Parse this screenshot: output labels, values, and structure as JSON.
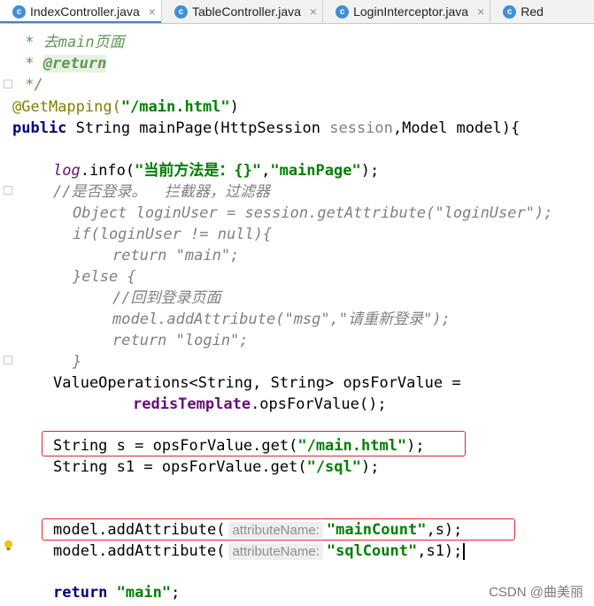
{
  "tabs": [
    {
      "label": "IndexController.java",
      "close": "×",
      "active": true
    },
    {
      "label": "TableController.java",
      "close": "×",
      "active": false
    },
    {
      "label": "LoginInterceptor.java",
      "close": "×",
      "active": false
    },
    {
      "label": "Red",
      "close": "",
      "active": false
    }
  ],
  "tab_icon_letter": "c",
  "code": {
    "l1": {
      "a": " * 去main页面"
    },
    "l2": {
      "a": " * ",
      "b": "@return"
    },
    "l3": {
      "a": " */"
    },
    "l4": {
      "ann": "@GetMapping(",
      "str": "\"/main.html\"",
      "end": ")"
    },
    "l5": {
      "kw": "public",
      "rest": " String mainPage(HttpSession ",
      "dim": "session",
      "rest2": ",Model model){"
    },
    "l6": {
      "log": "log",
      "a": ".info(",
      "s1": "\"当前方法是：{}\"",
      "b": ",",
      "s2": "\"mainPage\"",
      "c": ");"
    },
    "l7": {
      "a": "//是否登录。  拦截器，过滤器"
    },
    "l8": {
      "a": "Object loginUser = session.getAttribute(\"loginUser\");"
    },
    "l9": {
      "a": "if(loginUser != null){"
    },
    "l10": {
      "a": "return \"main\";"
    },
    "l11": {
      "a": "}else {"
    },
    "l12": {
      "a": "//回到登录页面"
    },
    "l13": {
      "a": "model.addAttribute(\"msg\",\"请重新登录\");"
    },
    "l14": {
      "a": "return \"login\";"
    },
    "l15": {
      "a": "}"
    },
    "l16": {
      "a": "ValueOperations<String, String> opsForValue ="
    },
    "l17": {
      "fld": "redisTemplate",
      "a": ".opsForValue();"
    },
    "l18": {
      "a": "String s = opsForValue.get(",
      "str": "\"/main.html\"",
      "end": ");"
    },
    "l19": {
      "a": "String s1 = opsForValue.get(",
      "str": "\"/sql\"",
      "end": ");"
    },
    "l20": {
      "a": "model.addAttribute(",
      "hint": "attributeName:",
      "str": "\"mainCount\"",
      "end": ",s);"
    },
    "l21": {
      "a": "model.addAttribute(",
      "hint": "attributeName:",
      "str": "\"sqlCount\"",
      "end": ",s1);"
    },
    "l22": {
      "kw": "return",
      "str": "\"main\"",
      "end": ";"
    }
  },
  "watermark": "CSDN @曲美丽",
  "colors": {
    "keyword": "#000080",
    "string": "#008000",
    "comment": "#808080",
    "annotation": "#808000",
    "field": "#660e7a",
    "highlight_box": "#e0262b",
    "tab_underline": "#4083c9"
  }
}
